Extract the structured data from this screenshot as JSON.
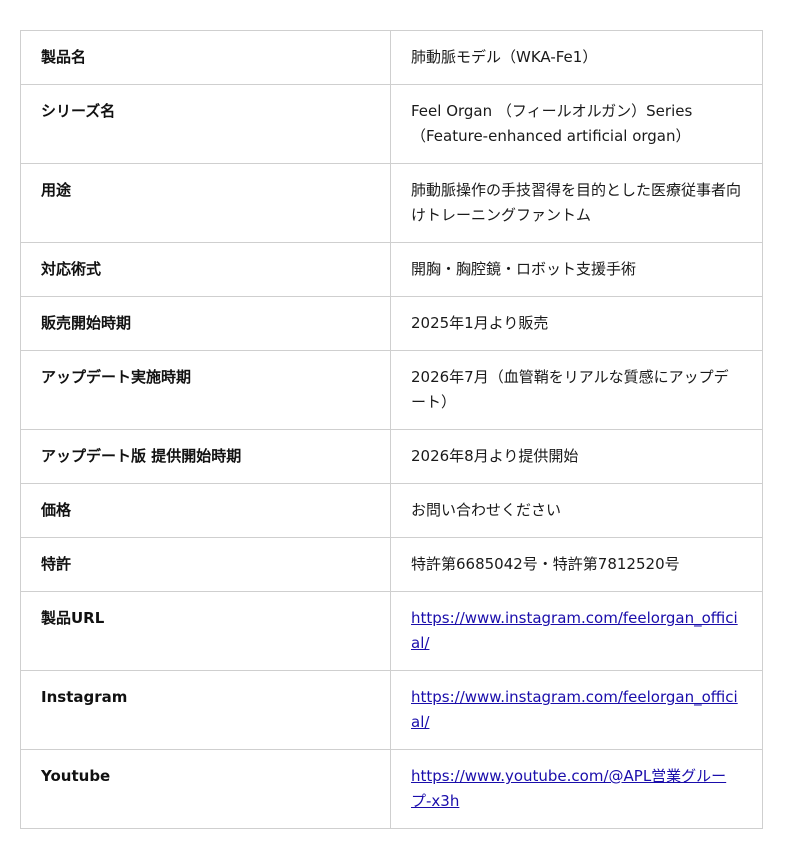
{
  "rows": [
    {
      "label": "製品名",
      "value": "肺動脈モデル（WKA-Fe1）"
    },
    {
      "label": "シリーズ名",
      "value": "Feel Organ （フィールオルガン）Series（Feature-enhanced artificial organ）"
    },
    {
      "label": "用途",
      "value": "肺動脈操作の手技習得を目的とした医療従事者向けトレーニングファントム"
    },
    {
      "label": "対応術式",
      "value": "開胸・胸腔鏡・ロボット支援手術"
    },
    {
      "label": "販売開始時期",
      "value": "2025年1月より販売"
    },
    {
      "label": "アップデート実施時期",
      "value": "2026年7月（血管鞘をリアルな質感にアップデート）"
    },
    {
      "label": "アップデート版 提供開始時期",
      "value": "2026年8月より提供開始"
    },
    {
      "label": "価格",
      "value": "お問い合わせください"
    },
    {
      "label": "特許",
      "value": "特許第6685042号・特許第7812520号"
    },
    {
      "label": "製品URL",
      "value": "https://www.instagram.com/feelorgan_official/"
    },
    {
      "label": "Instagram",
      "value": "https://www.instagram.com/feelorgan_official/"
    },
    {
      "label": "Youtube",
      "value": "https://www.youtube.com/@APL営業グループ-x3h"
    }
  ],
  "colors": {
    "link": "#1a0dab",
    "border": "#cfcfcf",
    "text": "#111111"
  }
}
